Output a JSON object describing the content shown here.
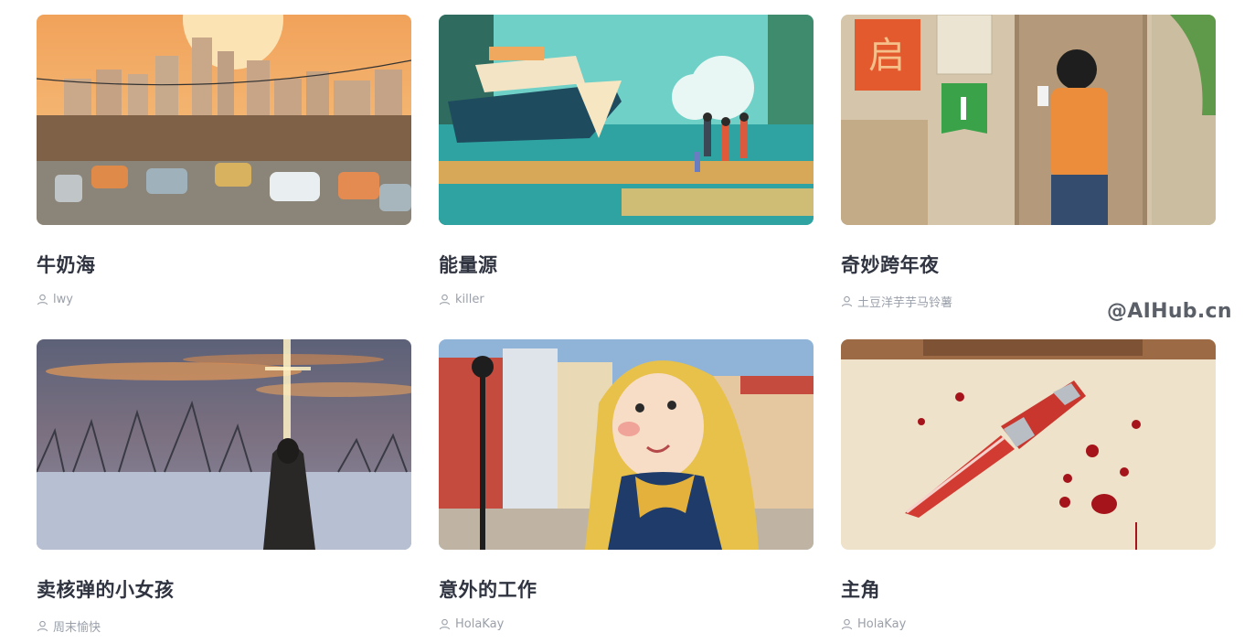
{
  "cards": [
    {
      "title": "牛奶海",
      "author": "lwy",
      "image": "city-traffic-sunset-illustration"
    },
    {
      "title": "能量源",
      "author": "killer",
      "image": "ship-beach-family-illustration"
    },
    {
      "title": "奇妙跨年夜",
      "author": "土豆洋芋芋马铃薯",
      "image": "boy-door-phone-illustration"
    },
    {
      "title": "卖核弹的小女孩",
      "author": "周末愉快",
      "image": "girl-snowfield-light-illustration"
    },
    {
      "title": "意外的工作",
      "author": "HolaKay",
      "image": "blonde-girl-town-illustration"
    },
    {
      "title": "主角",
      "author": "HolaKay",
      "image": "bloody-knife-illustration"
    }
  ],
  "watermark": "@AIHub.cn",
  "colors": {
    "title": "#2f3440",
    "author": "#9aa0aa"
  }
}
